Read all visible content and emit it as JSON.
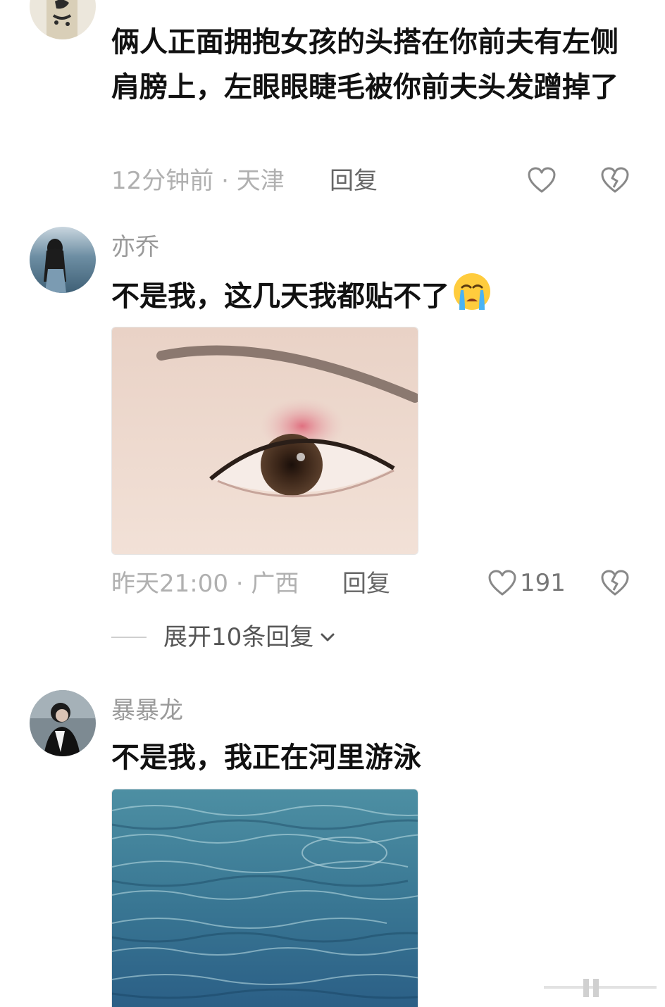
{
  "comments": [
    {
      "username": "",
      "text": "俩人正面拥抱女孩的头搭在你前夫有左侧肩膀上，左眼眼睫毛被你前夫头发蹭掉了",
      "time": "12分钟前",
      "location": "天津",
      "reply_label": "回复",
      "like_count": "",
      "avatar_icon": "calligraphy-avatar-icon"
    },
    {
      "username": "亦乔",
      "text": "不是我，这几天我都贴不了",
      "emoji": "crying-face-emoji",
      "time": "昨天21:00",
      "location": "广西",
      "reply_label": "回复",
      "like_count": "191",
      "avatar_icon": "girl-by-sea-avatar-icon",
      "image_icon": "eye-stye-photo"
    },
    {
      "username": "暴暴龙",
      "text": "不是我，我正在河里游泳",
      "avatar_icon": "person-avatar-icon",
      "image_icon": "river-water-photo"
    }
  ],
  "expand_replies": {
    "label": "展开10条回复",
    "icon": "chevron-down-icon"
  },
  "meta_separator": " · ",
  "colors": {
    "text": "#111111",
    "username": "#9a9a9a",
    "meta": "#b0b0b0",
    "reply": "#666666",
    "icon": "#888888"
  }
}
